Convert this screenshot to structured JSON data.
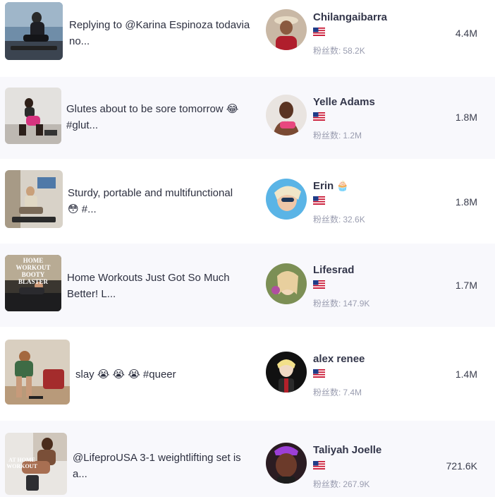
{
  "fans_label": "粉丝数:",
  "rows": [
    {
      "description_line1": "Replying to @Karina Espinoza todavia",
      "description_line2": "no...",
      "thumb_caption": "",
      "creator": "Chilangaibarra",
      "creator_badge": "",
      "country": "US",
      "fans": "58.2K",
      "views": "4.4M"
    },
    {
      "description_line1": "Glutes about to be sore tomorrow 😂",
      "description_line2": "#glut...",
      "thumb_caption": "",
      "creator": "Yelle Adams",
      "creator_badge": "",
      "country": "US",
      "fans": "1.2M",
      "views": "1.8M"
    },
    {
      "description_line1": "Sturdy, portable and multifunctional",
      "description_line2": "😳 #...",
      "thumb_caption": "",
      "creator": "Erin",
      "creator_badge": "🧁",
      "country": "US",
      "fans": "32.6K",
      "views": "1.8M"
    },
    {
      "description_line1": "Home Workouts Just Got So Much",
      "description_line2": "Better! L...",
      "thumb_caption": "HOME WORKOUT BOOTY BLASTER",
      "creator": "Lifesrad",
      "creator_badge": "",
      "country": "US",
      "fans": "147.9K",
      "views": "1.7M"
    },
    {
      "description_line1": "slay 😭 😭 😭 #queer",
      "description_line2": "",
      "thumb_caption": "",
      "creator": "alex renee",
      "creator_badge": "",
      "country": "US",
      "fans": "7.4M",
      "views": "1.4M"
    },
    {
      "description_line1": "@LifeproUSA 3-1 weightlifting set is",
      "description_line2": "a...",
      "thumb_caption": "AT HOME WORKOUT",
      "creator": "Taliyah Joelle",
      "creator_badge": "",
      "country": "US",
      "fans": "267.9K",
      "views": "721.6K"
    }
  ]
}
